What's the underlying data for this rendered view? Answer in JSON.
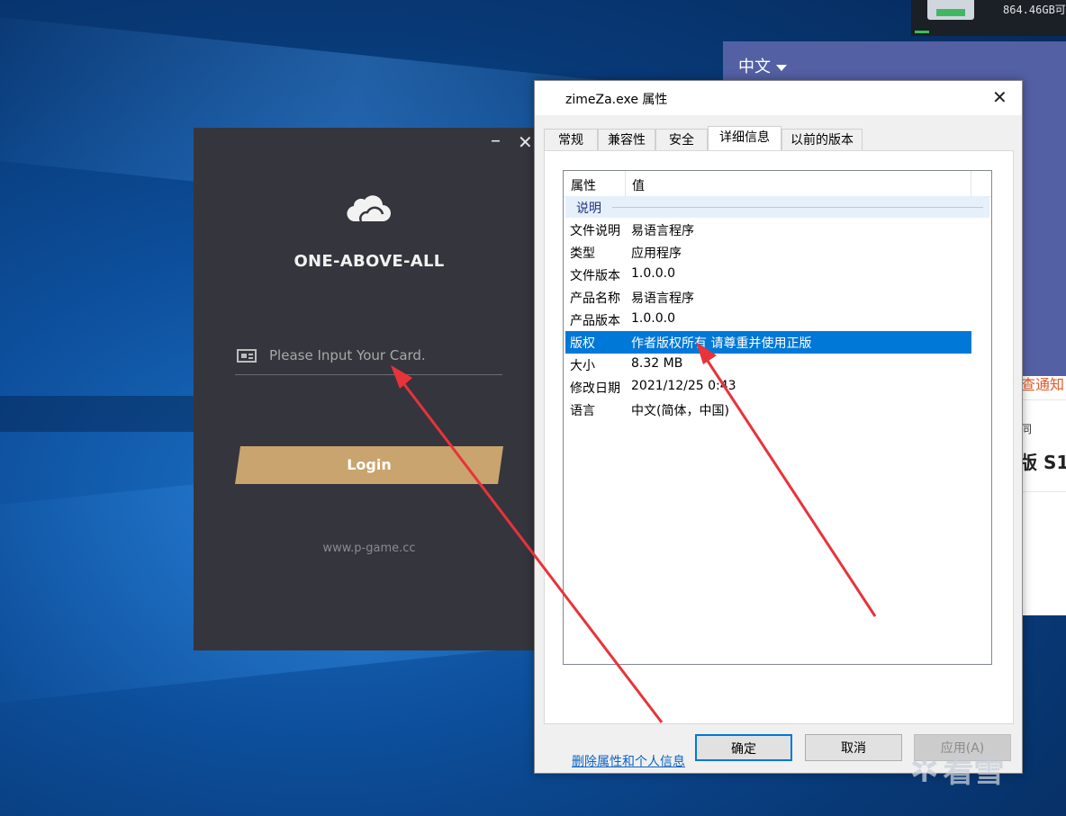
{
  "desktop": {
    "disk_text": "864.46GB可",
    "language_label": "中文",
    "side_panel": {
      "notice_text": "查通知",
      "mini_text": "同",
      "s1_text": "版 S1"
    },
    "watermark_text": "看雪"
  },
  "login_window": {
    "minimize_glyph": "–",
    "close_glyph": "✕",
    "title": "ONE-ABOVE-ALL",
    "card_input": {
      "value": "",
      "placeholder": "Please Input Your Card."
    },
    "login_button": "Login",
    "url": "www.p-game.cc"
  },
  "properties_dialog": {
    "title": "zimeZa.exe 属性",
    "close_glyph": "✕",
    "tabs": [
      {
        "label": "常规"
      },
      {
        "label": "兼容性"
      },
      {
        "label": "安全"
      },
      {
        "label": "详细信息"
      },
      {
        "label": "以前的版本"
      }
    ],
    "active_tab": "详细信息",
    "columns": {
      "property": "属性",
      "value": "值"
    },
    "group_label": "说明",
    "rows": [
      {
        "key": "文件说明",
        "value": "易语言程序"
      },
      {
        "key": "类型",
        "value": "应用程序"
      },
      {
        "key": "文件版本",
        "value": "1.0.0.0"
      },
      {
        "key": "产品名称",
        "value": "易语言程序"
      },
      {
        "key": "产品版本",
        "value": "1.0.0.0"
      },
      {
        "key": "版权",
        "value": "作者版权所有 请尊重并使用正版"
      },
      {
        "key": "大小",
        "value": "8.32 MB"
      },
      {
        "key": "修改日期",
        "value": "2021/12/25 0:43"
      },
      {
        "key": "语言",
        "value": "中文(简体，中国)"
      }
    ],
    "selected_row": "版权",
    "remove_link": "删除属性和个人信息",
    "buttons": {
      "ok": "确定",
      "cancel": "取消",
      "apply": "应用(A)"
    }
  },
  "colors": {
    "selection": "#0078d7",
    "login_bg": "#35353d",
    "login_button": "#c9a46e",
    "annotation_arrow": "#e8333a"
  }
}
